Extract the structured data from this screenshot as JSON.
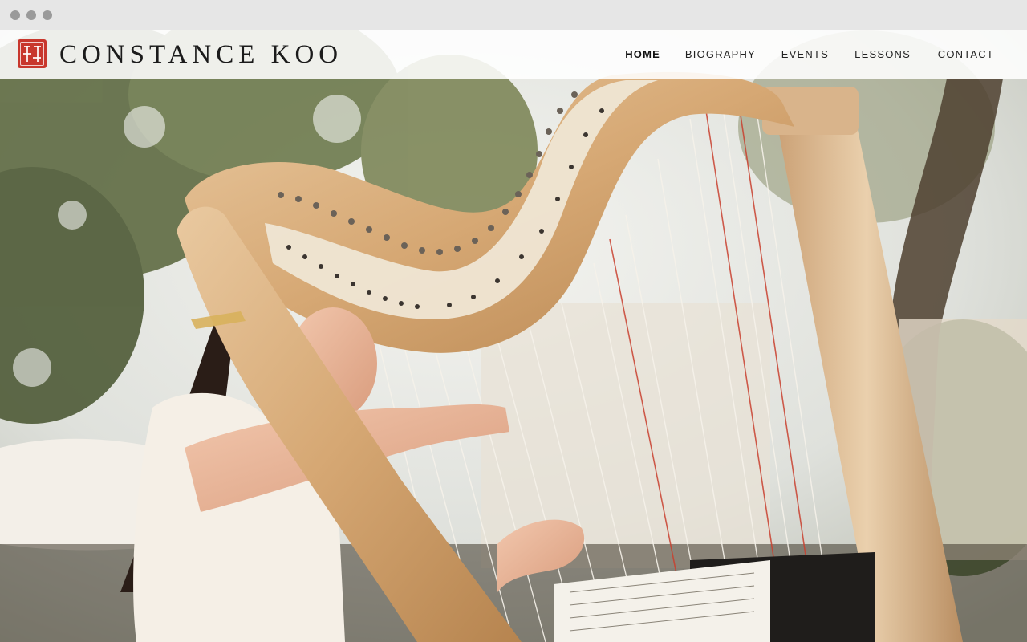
{
  "site": {
    "title": "CONSTANCE KOO",
    "logo_icon": "chinese-seal-logo-icon",
    "brand_color": "#c8372d"
  },
  "nav": {
    "items": [
      {
        "label": "HOME",
        "active": true
      },
      {
        "label": "BIOGRAPHY",
        "active": false
      },
      {
        "label": "EVENTS",
        "active": false
      },
      {
        "label": "LESSONS",
        "active": false
      },
      {
        "label": "CONTACT",
        "active": false
      }
    ]
  },
  "hero": {
    "image_icon": "harp-performance-photo"
  }
}
